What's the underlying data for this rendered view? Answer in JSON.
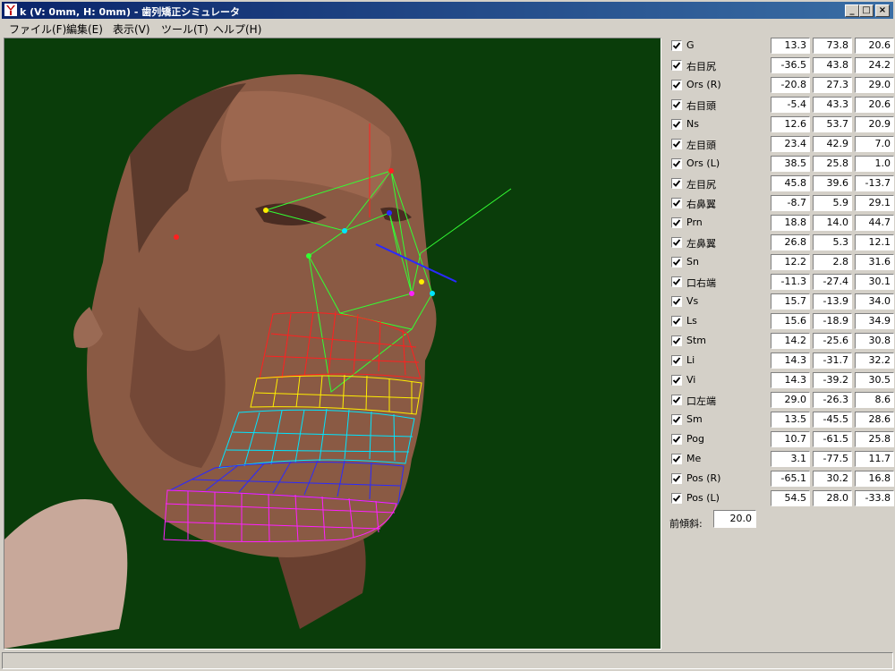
{
  "window": {
    "title": "k (V: 0mm, H: 0mm) - 歯列矯正シミュレータ",
    "controls": {
      "minimize": "_",
      "maximize": "□",
      "close": "×"
    }
  },
  "menu": [
    {
      "label": "ファイル(F)"
    },
    {
      "label": "編集(E)"
    },
    {
      "label": "表示(V)"
    },
    {
      "label": "ツール(T)"
    },
    {
      "label": "ヘルプ(H)"
    }
  ],
  "landmarks": [
    {
      "name": "G",
      "checked": true,
      "values": [
        "13.3",
        "73.8",
        "20.6"
      ]
    },
    {
      "name": "右目尻",
      "checked": true,
      "values": [
        "-36.5",
        "43.8",
        "24.2"
      ]
    },
    {
      "name": "Ors (R)",
      "checked": true,
      "values": [
        "-20.8",
        "27.3",
        "29.0"
      ]
    },
    {
      "name": "右目頭",
      "checked": true,
      "values": [
        "-5.4",
        "43.3",
        "20.6"
      ]
    },
    {
      "name": "Ns",
      "checked": true,
      "values": [
        "12.6",
        "53.7",
        "20.9"
      ]
    },
    {
      "name": "左目頭",
      "checked": true,
      "values": [
        "23.4",
        "42.9",
        "7.0"
      ]
    },
    {
      "name": "Ors (L)",
      "checked": true,
      "values": [
        "38.5",
        "25.8",
        "1.0"
      ]
    },
    {
      "name": "左目尻",
      "checked": true,
      "values": [
        "45.8",
        "39.6",
        "-13.7"
      ]
    },
    {
      "name": "右鼻翼",
      "checked": true,
      "values": [
        "-8.7",
        "5.9",
        "29.1"
      ]
    },
    {
      "name": "Prn",
      "checked": true,
      "values": [
        "18.8",
        "14.0",
        "44.7"
      ]
    },
    {
      "name": "左鼻翼",
      "checked": true,
      "values": [
        "26.8",
        "5.3",
        "12.1"
      ]
    },
    {
      "name": "Sn",
      "checked": true,
      "values": [
        "12.2",
        "2.8",
        "31.6"
      ]
    },
    {
      "name": "口右端",
      "checked": true,
      "values": [
        "-11.3",
        "-27.4",
        "30.1"
      ]
    },
    {
      "name": "Vs",
      "checked": true,
      "values": [
        "15.7",
        "-13.9",
        "34.0"
      ]
    },
    {
      "name": "Ls",
      "checked": true,
      "values": [
        "15.6",
        "-18.9",
        "34.9"
      ]
    },
    {
      "name": "Stm",
      "checked": true,
      "values": [
        "14.2",
        "-25.6",
        "30.8"
      ]
    },
    {
      "name": "Li",
      "checked": true,
      "values": [
        "14.3",
        "-31.7",
        "32.2"
      ]
    },
    {
      "name": "Vi",
      "checked": true,
      "values": [
        "14.3",
        "-39.2",
        "30.5"
      ]
    },
    {
      "name": "口左端",
      "checked": true,
      "values": [
        "29.0",
        "-26.3",
        "8.6"
      ]
    },
    {
      "name": "Sm",
      "checked": true,
      "values": [
        "13.5",
        "-45.5",
        "28.6"
      ]
    },
    {
      "name": "Pog",
      "checked": true,
      "values": [
        "10.7",
        "-61.5",
        "25.8"
      ]
    },
    {
      "name": "Me",
      "checked": true,
      "values": [
        "3.1",
        "-77.5",
        "11.7"
      ]
    },
    {
      "name": "Pos (R)",
      "checked": true,
      "values": [
        "-65.1",
        "30.2",
        "16.8"
      ]
    },
    {
      "name": "Pos (L)",
      "checked": true,
      "values": [
        "54.5",
        "28.0",
        "-33.8"
      ]
    }
  ],
  "tilt": {
    "label": "前傾斜:",
    "value": "20.0"
  },
  "colors": {
    "viewport_bg": "#0a3d0a",
    "skin": "#8a5a44",
    "wire_green": "#33ff33",
    "mesh_red": "#ff2020",
    "mesh_yellow": "#ffee00",
    "mesh_cyan": "#00e5ff",
    "mesh_blue": "#2a2aff",
    "mesh_magenta": "#ff20ff"
  }
}
